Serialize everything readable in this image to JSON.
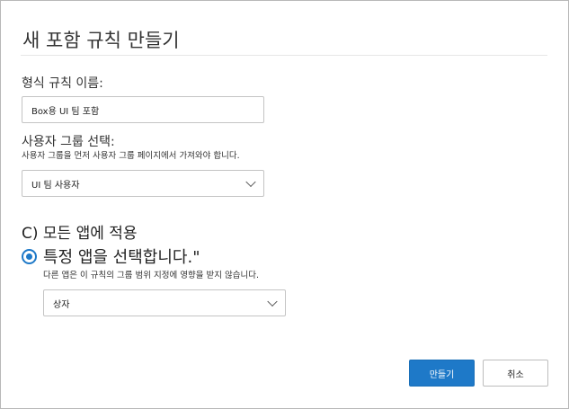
{
  "dialog": {
    "title": "새 포함 규칙 만들기",
    "rule_name_label": "형식 규칙 이름:",
    "rule_name_value": "Box용 UI 팀 포함",
    "group_label": "사용자 그룹 선택:",
    "group_hint": "사용자 그룹을 먼저 사용자 그룹 페이지에서 가져와야 합니다.",
    "group_value": "UI 팀 사용자",
    "apply_all_label": "C) 모든 앱에 적용",
    "specific_apps_label": "특정 앱을 선택합니다.\"",
    "specific_apps_hint": "다른 앱은 이 규칙의 그룹 범위 지정에 영향을 받지 않습니다.",
    "app_value": "상자",
    "create_button": "만들기",
    "cancel_button": "취소"
  },
  "colors": {
    "accent": "#1e79c8"
  }
}
